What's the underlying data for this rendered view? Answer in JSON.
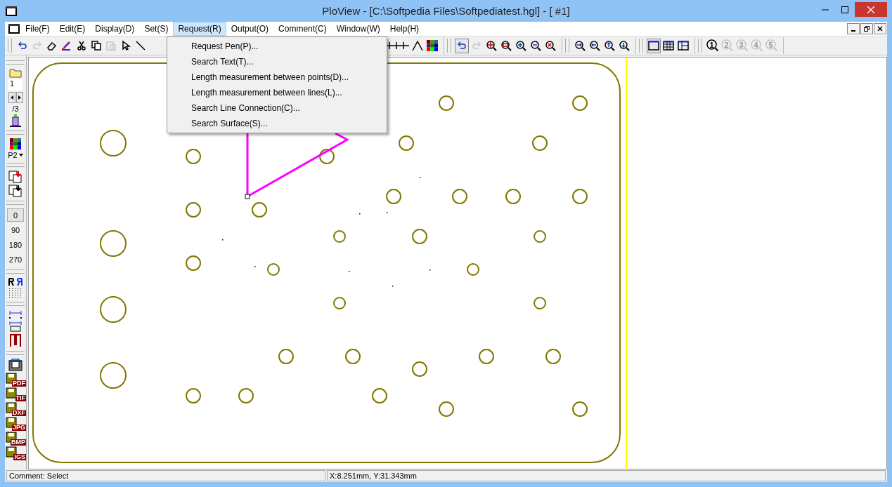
{
  "window": {
    "title": "PloView - [C:\\Softpedia Files\\Softpediatest.hgl] - [ #1]"
  },
  "menu": [
    {
      "label": "File(F)",
      "selected": false
    },
    {
      "label": "Edit(E)",
      "selected": false
    },
    {
      "label": "Display(D)",
      "selected": false
    },
    {
      "label": "Set(S)",
      "selected": false
    },
    {
      "label": "Request(R)",
      "selected": true
    },
    {
      "label": "Output(O)",
      "selected": false
    },
    {
      "label": "Comment(C)",
      "selected": false
    },
    {
      "label": "Window(W)",
      "selected": false
    },
    {
      "label": "Help(H)",
      "selected": false
    }
  ],
  "dropdown": [
    "Request Pen(P)...",
    "Search Text(T)...",
    "Length measurement between points(D)...",
    "Length measurement between lines(L)...",
    "Search Line Connection(C)...",
    "Search Surface(S)..."
  ],
  "toolbar": [
    [
      {
        "kind": "undo",
        "disabled": false
      },
      {
        "kind": "redo",
        "disabled": true
      },
      {
        "kind": "eraser",
        "disabled": false
      },
      {
        "kind": "pen",
        "disabled": false
      },
      {
        "kind": "cut",
        "disabled": false
      },
      {
        "kind": "copy",
        "disabled": false
      },
      {
        "kind": "paste",
        "disabled": true
      },
      {
        "kind": "pointer",
        "disabled": false
      },
      {
        "kind": "line",
        "disabled": false
      },
      {
        "kind": "ticks",
        "disabled": false
      },
      {
        "kind": "peak",
        "disabled": false
      },
      {
        "kind": "palette",
        "disabled": false
      }
    ],
    [
      {
        "kind": "undo",
        "disabled": false,
        "selected": true
      },
      {
        "kind": "redo",
        "disabled": true,
        "selected": false
      },
      {
        "kind": "zoomfit",
        "disabled": false
      },
      {
        "kind": "zoomwin",
        "disabled": false
      },
      {
        "kind": "zoomin",
        "disabled": false
      },
      {
        "kind": "zoomout",
        "disabled": false
      },
      {
        "kind": "zoomreset",
        "disabled": false
      }
    ],
    [
      {
        "kind": "panright",
        "disabled": false
      },
      {
        "kind": "panleft",
        "disabled": false
      },
      {
        "kind": "panup",
        "disabled": false
      },
      {
        "kind": "pandown",
        "disabled": false
      }
    ],
    [
      {
        "kind": "single",
        "disabled": false,
        "selected": true
      },
      {
        "kind": "grid",
        "disabled": false,
        "selected": false
      },
      {
        "kind": "split",
        "disabled": false,
        "selected": false
      }
    ],
    [
      {
        "kind": "num",
        "label": "1",
        "disabled": false
      },
      {
        "kind": "num",
        "label": "2",
        "disabled": true
      },
      {
        "kind": "num",
        "label": "3",
        "disabled": true
      },
      {
        "kind": "num",
        "label": "4",
        "disabled": true
      },
      {
        "kind": "num",
        "label": "5",
        "disabled": true
      }
    ]
  ],
  "side": {
    "page": "1",
    "pages": "/3",
    "pen": "P2",
    "rotations": [
      {
        "label": "0",
        "selected": true
      },
      {
        "label": "90",
        "selected": false
      },
      {
        "label": "180",
        "selected": false
      },
      {
        "label": "270",
        "selected": false
      }
    ],
    "exports": [
      "PDF",
      "TIF",
      "DXF",
      "JPG",
      "BMP",
      "IGS"
    ]
  },
  "status_bar": {
    "comment": "Comment: Select",
    "coords": "X:8.251mm, Y:31.343mm"
  }
}
